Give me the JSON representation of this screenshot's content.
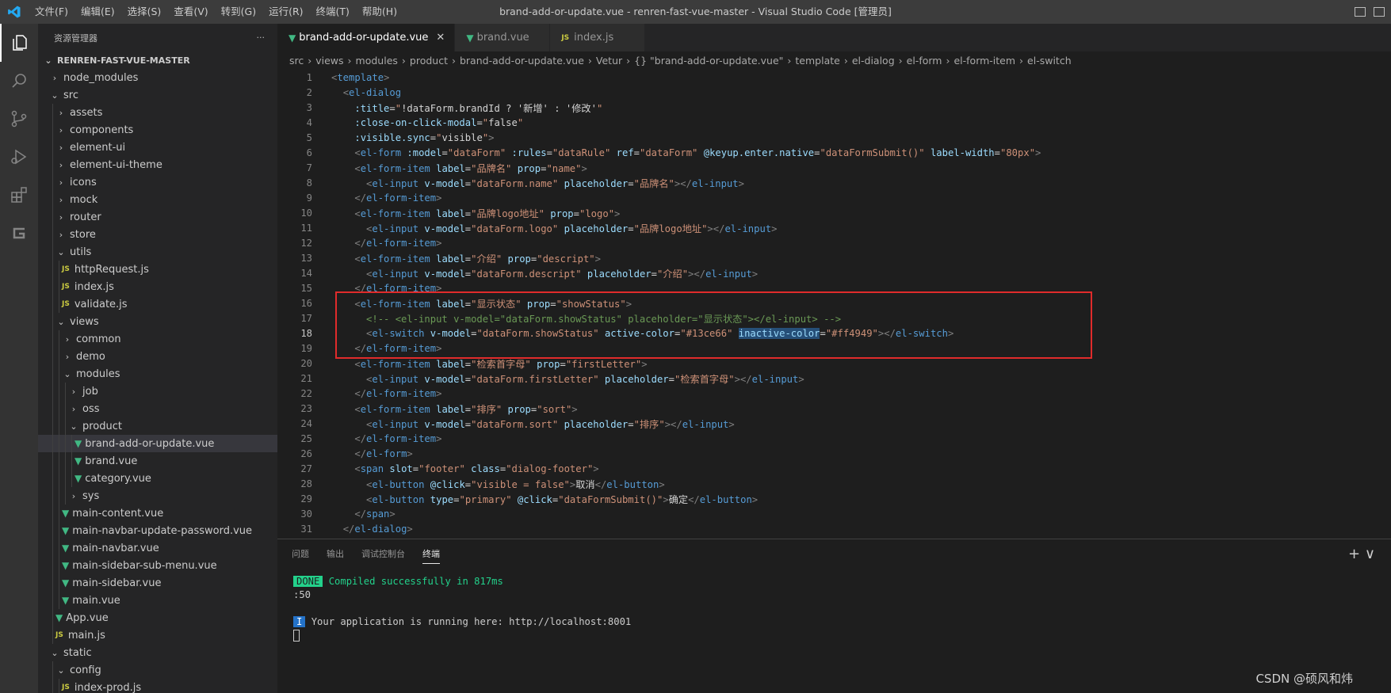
{
  "window": {
    "title": "brand-add-or-update.vue - renren-fast-vue-master - Visual Studio Code [管理员]",
    "menu": [
      "文件(F)",
      "编辑(E)",
      "选择(S)",
      "查看(V)",
      "转到(G)",
      "运行(R)",
      "终端(T)",
      "帮助(H)"
    ]
  },
  "activity_bar": [
    "explorer-icon",
    "search-icon",
    "source-control-icon",
    "run-debug-icon",
    "extensions-icon",
    "gitlens-icon"
  ],
  "sidebar": {
    "header": "资源管理器",
    "more": "···",
    "section": "RENREN-FAST-VUE-MASTER",
    "tree": [
      {
        "label": "node_modules",
        "type": "folder",
        "open": false,
        "depth": 0
      },
      {
        "label": "src",
        "type": "folder",
        "open": true,
        "depth": 0
      },
      {
        "label": "assets",
        "type": "folder",
        "open": false,
        "depth": 1
      },
      {
        "label": "components",
        "type": "folder",
        "open": false,
        "depth": 1
      },
      {
        "label": "element-ui",
        "type": "folder",
        "open": false,
        "depth": 1
      },
      {
        "label": "element-ui-theme",
        "type": "folder",
        "open": false,
        "depth": 1
      },
      {
        "label": "icons",
        "type": "folder",
        "open": false,
        "depth": 1
      },
      {
        "label": "mock",
        "type": "folder",
        "open": false,
        "depth": 1
      },
      {
        "label": "router",
        "type": "folder",
        "open": false,
        "depth": 1
      },
      {
        "label": "store",
        "type": "folder",
        "open": false,
        "depth": 1
      },
      {
        "label": "utils",
        "type": "folder",
        "open": true,
        "depth": 1
      },
      {
        "label": "httpRequest.js",
        "type": "js",
        "depth": 2
      },
      {
        "label": "index.js",
        "type": "js",
        "depth": 2
      },
      {
        "label": "validate.js",
        "type": "js",
        "depth": 2
      },
      {
        "label": "views",
        "type": "folder",
        "open": true,
        "depth": 1
      },
      {
        "label": "common",
        "type": "folder",
        "open": false,
        "depth": 2
      },
      {
        "label": "demo",
        "type": "folder",
        "open": false,
        "depth": 2
      },
      {
        "label": "modules",
        "type": "folder",
        "open": true,
        "depth": 2
      },
      {
        "label": "job",
        "type": "folder",
        "open": false,
        "depth": 3
      },
      {
        "label": "oss",
        "type": "folder",
        "open": false,
        "depth": 3
      },
      {
        "label": "product",
        "type": "folder",
        "open": true,
        "depth": 3
      },
      {
        "label": "brand-add-or-update.vue",
        "type": "vue",
        "depth": 4,
        "selected": true
      },
      {
        "label": "brand.vue",
        "type": "vue",
        "depth": 4
      },
      {
        "label": "category.vue",
        "type": "vue",
        "depth": 4
      },
      {
        "label": "sys",
        "type": "folder",
        "open": false,
        "depth": 3
      },
      {
        "label": "main-content.vue",
        "type": "vue",
        "depth": 2
      },
      {
        "label": "main-navbar-update-password.vue",
        "type": "vue",
        "depth": 2
      },
      {
        "label": "main-navbar.vue",
        "type": "vue",
        "depth": 2
      },
      {
        "label": "main-sidebar-sub-menu.vue",
        "type": "vue",
        "depth": 2
      },
      {
        "label": "main-sidebar.vue",
        "type": "vue",
        "depth": 2
      },
      {
        "label": "main.vue",
        "type": "vue",
        "depth": 2
      },
      {
        "label": "App.vue",
        "type": "vue",
        "depth": 1
      },
      {
        "label": "main.js",
        "type": "js",
        "depth": 1
      },
      {
        "label": "static",
        "type": "folder",
        "open": true,
        "depth": 0
      },
      {
        "label": "config",
        "type": "folder",
        "open": true,
        "depth": 1
      },
      {
        "label": "index-prod.js",
        "type": "js",
        "depth": 2
      }
    ]
  },
  "editor": {
    "tabs": [
      {
        "label": "brand-add-or-update.vue",
        "kind": "vue",
        "active": true,
        "close": "✕"
      },
      {
        "label": "brand.vue",
        "kind": "vue",
        "active": false
      },
      {
        "label": "index.js",
        "kind": "js",
        "active": false
      }
    ],
    "breadcrumb": [
      "src",
      "views",
      "modules",
      "product",
      "brand-add-or-update.vue",
      "Vetur",
      "{} \"brand-add-or-update.vue\"",
      "template",
      "el-dialog",
      "el-form",
      "el-form-item",
      "el-switch"
    ],
    "current_line": 18,
    "lines": [
      {
        "n": "1",
        "text": "<template>"
      },
      {
        "n": "2",
        "text": "  <el-dialog"
      },
      {
        "n": "3",
        "text": "    :title=\"!dataForm.brandId ? '新增' : '修改'\""
      },
      {
        "n": "4",
        "text": "    :close-on-click-modal=\"false\""
      },
      {
        "n": "5",
        "text": "    :visible.sync=\"visible\">"
      },
      {
        "n": "6",
        "text": "    <el-form :model=\"dataForm\" :rules=\"dataRule\" ref=\"dataForm\" @keyup.enter.native=\"dataFormSubmit()\" label-width=\"80px\">"
      },
      {
        "n": "7",
        "text": "    <el-form-item label=\"品牌名\" prop=\"name\">"
      },
      {
        "n": "8",
        "text": "      <el-input v-model=\"dataForm.name\" placeholder=\"品牌名\"></el-input>"
      },
      {
        "n": "9",
        "text": "    </el-form-item>"
      },
      {
        "n": "10",
        "text": "    <el-form-item label=\"品牌logo地址\" prop=\"logo\">"
      },
      {
        "n": "11",
        "text": "      <el-input v-model=\"dataForm.logo\" placeholder=\"品牌logo地址\"></el-input>"
      },
      {
        "n": "12",
        "text": "    </el-form-item>"
      },
      {
        "n": "13",
        "text": "    <el-form-item label=\"介绍\" prop=\"descript\">"
      },
      {
        "n": "14",
        "text": "      <el-input v-model=\"dataForm.descript\" placeholder=\"介绍\"></el-input>"
      },
      {
        "n": "15",
        "text": "    </el-form-item>"
      },
      {
        "n": "16",
        "text": "    <el-form-item label=\"显示状态\" prop=\"showStatus\">"
      },
      {
        "n": "17",
        "text": "      <!-- <el-input v-model=\"dataForm.showStatus\" placeholder=\"显示状态\"></el-input> -->"
      },
      {
        "n": "18",
        "text": "      <el-switch v-model=\"dataForm.showStatus\" active-color=\"#13ce66\" inactive-color=\"#ff4949\"></el-switch>"
      },
      {
        "n": "19",
        "text": "    </el-form-item>"
      },
      {
        "n": "20",
        "text": "    <el-form-item label=\"检索首字母\" prop=\"firstLetter\">"
      },
      {
        "n": "21",
        "text": "      <el-input v-model=\"dataForm.firstLetter\" placeholder=\"检索首字母\"></el-input>"
      },
      {
        "n": "22",
        "text": "    </el-form-item>"
      },
      {
        "n": "23",
        "text": "    <el-form-item label=\"排序\" prop=\"sort\">"
      },
      {
        "n": "24",
        "text": "      <el-input v-model=\"dataForm.sort\" placeholder=\"排序\"></el-input>"
      },
      {
        "n": "25",
        "text": "    </el-form-item>"
      },
      {
        "n": "26",
        "text": "    </el-form>"
      },
      {
        "n": "27",
        "text": "    <span slot=\"footer\" class=\"dialog-footer\">"
      },
      {
        "n": "28",
        "text": "      <el-button @click=\"visible = false\">取消</el-button>"
      },
      {
        "n": "29",
        "text": "      <el-button type=\"primary\" @click=\"dataFormSubmit()\">确定</el-button>"
      },
      {
        "n": "30",
        "text": "    </span>"
      },
      {
        "n": "31",
        "text": "  </el-dialog>"
      }
    ],
    "highlight_word": "inactive-color"
  },
  "panel": {
    "tabs": [
      "问题",
      "输出",
      "调试控制台",
      "终端"
    ],
    "active_tab": "终端",
    "plus": "+ ∨",
    "terminal": {
      "done_badge": "DONE",
      "compiled": "Compiled successfully in 817ms",
      "time_suffix": ":50",
      "info_badge": "I",
      "running": "Your application is running here: http://localhost:8001"
    }
  },
  "watermark": "CSDN @硕风和炜",
  "colors": {
    "vue": "#41b883",
    "js": "#cbcb41",
    "highlight_box": "#e02b2b"
  }
}
